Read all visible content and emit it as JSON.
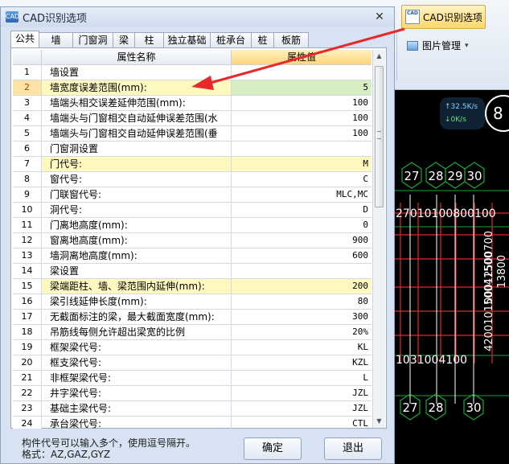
{
  "ribbon": {
    "cad_button_label": "CAD识别选项",
    "cad_button_icon_text": "CAD",
    "picture_button_label": "图片管理",
    "picture_button_caret": "▾"
  },
  "speed_widget": {
    "up": "↑32.5K/s",
    "down": "↓0K/s",
    "circle_digit": "8"
  },
  "cad_labels": {
    "top_row": [
      "27",
      "28",
      "29",
      "30"
    ],
    "dim1": "27010100800100",
    "dim2": "00012500700",
    "dim3": "13800",
    "dim4": "420010150041500",
    "dim5": "1031004100",
    "bottom_row": [
      "27",
      "28",
      "30"
    ]
  },
  "dialog": {
    "title": "CAD识别选项",
    "title_icon": "CAD",
    "close_glyph": "✕",
    "tabs": [
      "公共",
      "墙",
      "门窗洞",
      "梁",
      "柱",
      "独立基础",
      "桩承台",
      "桩",
      "板筋"
    ],
    "active_tab": 0,
    "grid": {
      "header_name": "属性名称",
      "header_value": "属性值",
      "rows": [
        {
          "num": "1",
          "name": "墙设置",
          "value": "",
          "style": "section"
        },
        {
          "num": "2",
          "name": "墙宽度误差范围(mm):",
          "value": "5",
          "style": "selected"
        },
        {
          "num": "3",
          "name": "墙端头相交误差延伸范围(mm):",
          "value": "100",
          "style": ""
        },
        {
          "num": "4",
          "name": "墙端头与门窗相交自动延伸误差范围(水",
          "value": "100",
          "style": ""
        },
        {
          "num": "5",
          "name": "墙端头与门窗相交自动延伸误差范围(垂",
          "value": "100",
          "style": ""
        },
        {
          "num": "6",
          "name": "门窗洞设置",
          "value": "",
          "style": "section"
        },
        {
          "num": "7",
          "name": "门代号:",
          "value": "M",
          "style": "yellow"
        },
        {
          "num": "8",
          "name": "窗代号:",
          "value": "C",
          "style": ""
        },
        {
          "num": "9",
          "name": "门联窗代号:",
          "value": "MLC,MC",
          "style": ""
        },
        {
          "num": "10",
          "name": "洞代号:",
          "value": "D",
          "style": ""
        },
        {
          "num": "11",
          "name": "门离地高度(mm):",
          "value": "0",
          "style": ""
        },
        {
          "num": "12",
          "name": "窗离地高度(mm):",
          "value": "900",
          "style": ""
        },
        {
          "num": "13",
          "name": "墙洞离地高度(mm):",
          "value": "600",
          "style": ""
        },
        {
          "num": "14",
          "name": "梁设置",
          "value": "",
          "style": "section"
        },
        {
          "num": "15",
          "name": "梁端距柱、墙、梁范围内延伸(mm):",
          "value": "200",
          "style": "yellow"
        },
        {
          "num": "16",
          "name": "梁引线延伸长度(mm):",
          "value": "80",
          "style": ""
        },
        {
          "num": "17",
          "name": "无截面标注的梁，最大截面宽度(mm):",
          "value": "300",
          "style": ""
        },
        {
          "num": "18",
          "name": "吊筋线每侧允许超出梁宽的比例",
          "value": "20%",
          "style": ""
        },
        {
          "num": "19",
          "name": "框架梁代号:",
          "value": "KL",
          "style": ""
        },
        {
          "num": "20",
          "name": "框支梁代号:",
          "value": "KZL",
          "style": ""
        },
        {
          "num": "21",
          "name": "非框架梁代号:",
          "value": "L",
          "style": ""
        },
        {
          "num": "22",
          "name": "井字梁代号:",
          "value": "JZL",
          "style": ""
        },
        {
          "num": "23",
          "name": "基础主梁代号:",
          "value": "JZL",
          "style": ""
        },
        {
          "num": "24",
          "name": "承台梁代号:",
          "value": "CTL",
          "style": ""
        }
      ]
    },
    "scroll_up": "▲",
    "scroll_down": "▼",
    "hint_line1": "构件代号可以输入多个，使用逗号隔开。",
    "hint_line2": "格式：AZ,GAZ,GYZ",
    "ok_label": "确定",
    "exit_label": "退出"
  },
  "colors": {
    "annotation_arrow": "#e8282a",
    "selected_value_bg": "#d6eec3",
    "highlight_row_bg": "#fff9c0"
  }
}
